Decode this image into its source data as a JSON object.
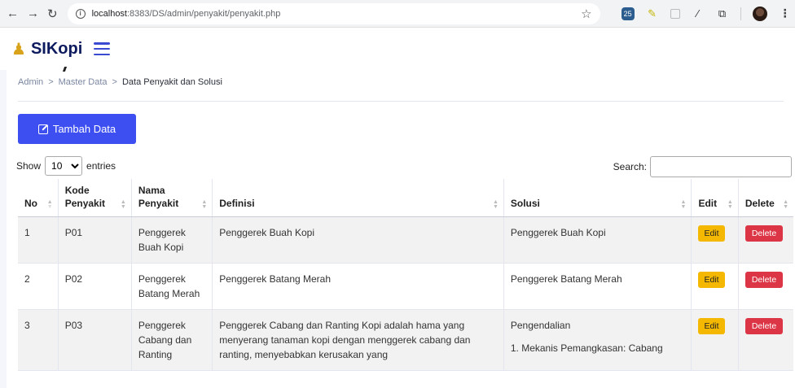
{
  "browser": {
    "url_host": "localhost",
    "url_path": ":8383/DS/admin/penyakit/penyakit.php"
  },
  "app": {
    "brand": "SIKopi"
  },
  "breadcrumb": {
    "items": [
      "Admin",
      "Master Data",
      "Data Penyakit dan Solusi"
    ],
    "separator": ">"
  },
  "toolbar": {
    "add_label": "Tambah Data"
  },
  "table_controls": {
    "show_label": "Show",
    "entries_value": "10",
    "entries_label": "entries",
    "search_label": "Search:",
    "search_value": ""
  },
  "table": {
    "headers": {
      "no": "No",
      "kode": "Kode Penyakit",
      "nama": "Nama Penyakit",
      "definisi": "Definisi",
      "solusi": "Solusi",
      "edit": "Edit",
      "delete": "Delete"
    },
    "rows": [
      {
        "no": "1",
        "kode": "P01",
        "nama": "Penggerek Buah Kopi",
        "definisi": "Penggerek Buah Kopi",
        "solusi_1": "Penggerek Buah Kopi",
        "solusi_2": ""
      },
      {
        "no": "2",
        "kode": "P02",
        "nama": "Penggerek Batang Merah",
        "definisi": "Penggerek Batang Merah",
        "solusi_1": "Penggerek Batang Merah",
        "solusi_2": ""
      },
      {
        "no": "3",
        "kode": "P03",
        "nama": "Penggerek Cabang dan Ranting",
        "definisi": "Penggerek Cabang dan Ranting Kopi adalah hama yang menyerang tanaman kopi dengan menggerek cabang dan ranting, menyebabkan kerusakan yang",
        "solusi_1": "Pengendalian",
        "solusi_2": "1. Mekanis Pemangkasan: Cabang"
      }
    ],
    "edit_label": "Edit",
    "delete_label": "Delete"
  },
  "colors": {
    "primary": "#3d4ff0",
    "edit": "#f5b800",
    "delete": "#dc3545",
    "brand": "#0d1b5e"
  }
}
